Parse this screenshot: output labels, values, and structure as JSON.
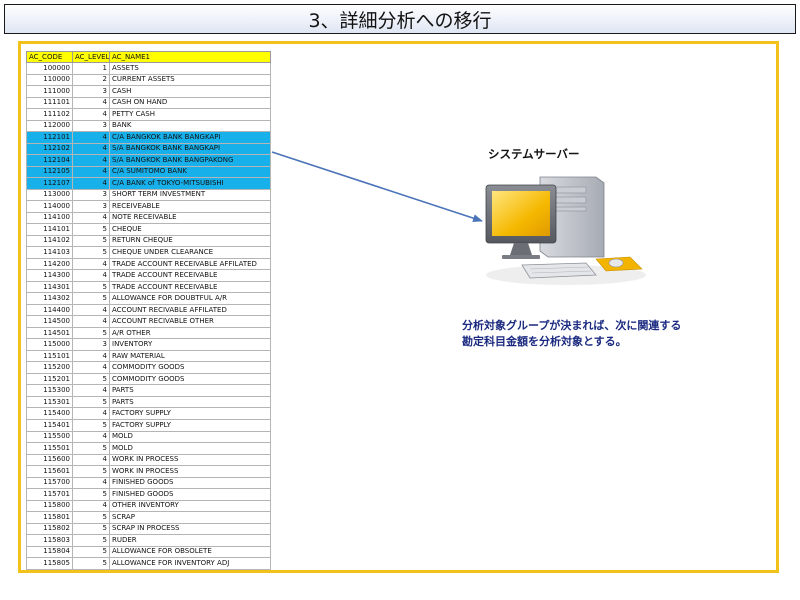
{
  "title": "3、詳細分析への移行",
  "table": {
    "headers": [
      "AC_CODE",
      "AC_LEVEL",
      "AC_NAME1"
    ],
    "rows": [
      {
        "code": "100000",
        "level": "1",
        "name": "ASSETS",
        "highlight": false
      },
      {
        "code": "110000",
        "level": "2",
        "name": "CURRENT ASSETS",
        "highlight": false
      },
      {
        "code": "111000",
        "level": "3",
        "name": "CASH",
        "highlight": false
      },
      {
        "code": "111101",
        "level": "4",
        "name": "CASH ON HAND",
        "highlight": false
      },
      {
        "code": "111102",
        "level": "4",
        "name": "PETTY CASH",
        "highlight": false
      },
      {
        "code": "112000",
        "level": "3",
        "name": "BANK",
        "highlight": false
      },
      {
        "code": "112101",
        "level": "4",
        "name": "C/A BANGKOK BANK BANGKAPI",
        "highlight": true
      },
      {
        "code": "112102",
        "level": "4",
        "name": "S/A BANGKOK BANK BANGKAPI",
        "highlight": true
      },
      {
        "code": "112104",
        "level": "4",
        "name": "S/A BANGKOK BANK BANGPAKONG",
        "highlight": true
      },
      {
        "code": "112105",
        "level": "4",
        "name": "C/A SUMITOMO BANK",
        "highlight": true
      },
      {
        "code": "112107",
        "level": "4",
        "name": "C/A BANK of TOKYO-MITSUBISHI",
        "highlight": true
      },
      {
        "code": "113000",
        "level": "3",
        "name": "SHORT TERM INVESTMENT",
        "highlight": false
      },
      {
        "code": "114000",
        "level": "3",
        "name": "RECEIVEABLE",
        "highlight": false
      },
      {
        "code": "114100",
        "level": "4",
        "name": "NOTE RECEIVABLE",
        "highlight": false
      },
      {
        "code": "114101",
        "level": "5",
        "name": "CHEQUE",
        "highlight": false
      },
      {
        "code": "114102",
        "level": "5",
        "name": "RETURN CHEQUE",
        "highlight": false
      },
      {
        "code": "114103",
        "level": "5",
        "name": "CHEQUE UNDER CLEARANCE",
        "highlight": false
      },
      {
        "code": "114200",
        "level": "4",
        "name": "TRADE ACCOUNT RECEIVABLE AFFILATED",
        "highlight": false
      },
      {
        "code": "114300",
        "level": "4",
        "name": "TRADE ACCOUNT RECEIVABLE",
        "highlight": false
      },
      {
        "code": "114301",
        "level": "5",
        "name": "TRADE ACCOUNT RECEIVABLE",
        "highlight": false
      },
      {
        "code": "114302",
        "level": "5",
        "name": "ALLOWANCE FOR DOUBTFUL A/R",
        "highlight": false
      },
      {
        "code": "114400",
        "level": "4",
        "name": "ACCOUNT RECIVABLE AFFILATED",
        "highlight": false
      },
      {
        "code": "114500",
        "level": "4",
        "name": "ACCOUNT RECIVABLE  OTHER",
        "highlight": false
      },
      {
        "code": "114501",
        "level": "5",
        "name": "A/R OTHER",
        "highlight": false
      },
      {
        "code": "115000",
        "level": "3",
        "name": "INVENTORY",
        "highlight": false
      },
      {
        "code": "115101",
        "level": "4",
        "name": "RAW MATERIAL",
        "highlight": false
      },
      {
        "code": "115200",
        "level": "4",
        "name": "COMMODITY GOODS",
        "highlight": false
      },
      {
        "code": "115201",
        "level": "5",
        "name": "COMMODITY GOODS",
        "highlight": false
      },
      {
        "code": "115300",
        "level": "4",
        "name": "PARTS",
        "highlight": false
      },
      {
        "code": "115301",
        "level": "5",
        "name": "PARTS",
        "highlight": false
      },
      {
        "code": "115400",
        "level": "4",
        "name": "FACTORY SUPPLY",
        "highlight": false
      },
      {
        "code": "115401",
        "level": "5",
        "name": "FACTORY SUPPLY",
        "highlight": false
      },
      {
        "code": "115500",
        "level": "4",
        "name": "MOLD",
        "highlight": false
      },
      {
        "code": "115501",
        "level": "5",
        "name": "MOLD",
        "highlight": false
      },
      {
        "code": "115600",
        "level": "4",
        "name": "WORK IN PROCESS",
        "highlight": false
      },
      {
        "code": "115601",
        "level": "5",
        "name": "WORK IN PROCESS",
        "highlight": false
      },
      {
        "code": "115700",
        "level": "4",
        "name": "FINISHED GOODS",
        "highlight": false
      },
      {
        "code": "115701",
        "level": "5",
        "name": "FINISHED GOODS",
        "highlight": false
      },
      {
        "code": "115800",
        "level": "4",
        "name": "OTHER INVENTORY",
        "highlight": false
      },
      {
        "code": "115801",
        "level": "5",
        "name": "SCRAP",
        "highlight": false
      },
      {
        "code": "115802",
        "level": "5",
        "name": "SCRAP IN PROCESS",
        "highlight": false
      },
      {
        "code": "115803",
        "level": "5",
        "name": "RUDER",
        "highlight": false
      },
      {
        "code": "115804",
        "level": "5",
        "name": "ALLOWANCE FOR OBSOLETE",
        "highlight": false
      },
      {
        "code": "115805",
        "level": "5",
        "name": "ALLOWANCE FOR INVENTORY ADJ",
        "highlight": false
      }
    ]
  },
  "server_label": "システムサーバー",
  "description": {
    "line1": "分析対象グループが決まれば、次に関連する",
    "line2": "勘定科目金額を分析対象とする。"
  },
  "colors": {
    "frame": "#f2c21a",
    "header": "#ffff00",
    "highlight": "#17b0ea",
    "arrow": "#4a73b8",
    "description_text": "#1b2a80"
  }
}
